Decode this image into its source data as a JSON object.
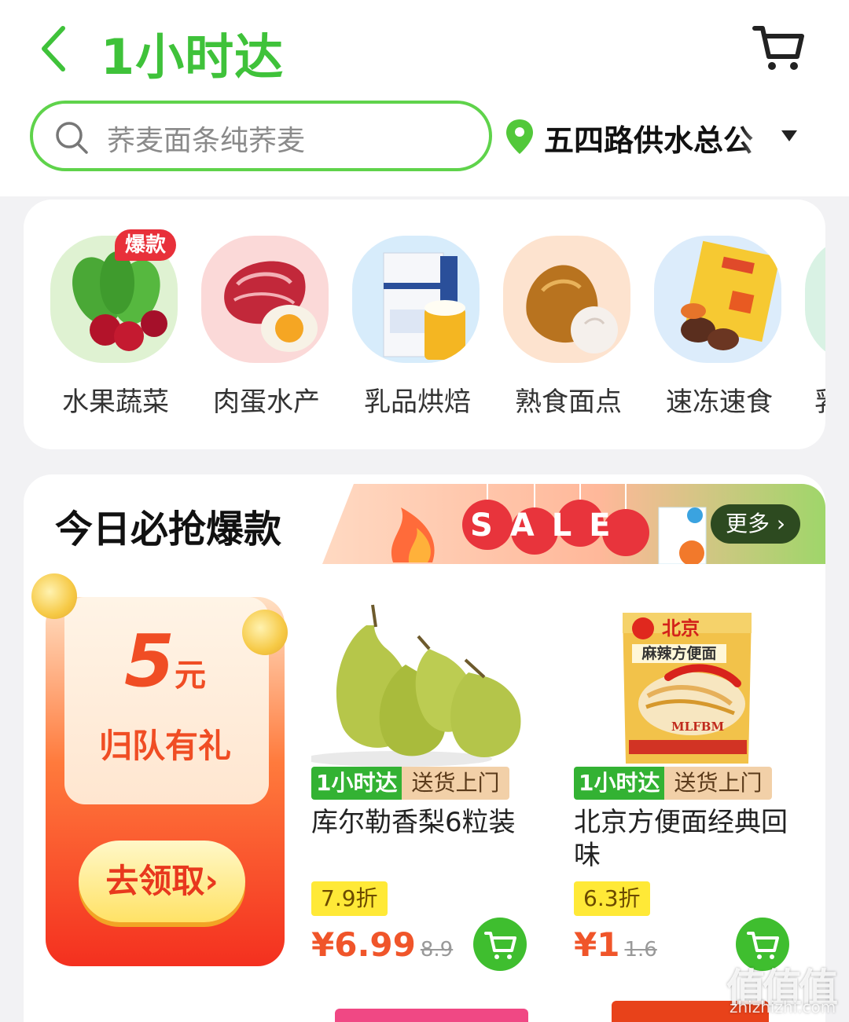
{
  "header": {
    "title": "1小时达",
    "back_icon": "chevron-left-icon",
    "cart_icon": "cart-icon"
  },
  "search": {
    "placeholder": "荞麦面条纯荞麦"
  },
  "location": {
    "text": "五四路供水总公"
  },
  "categories": [
    {
      "label": "水果蔬菜",
      "badge": "爆款"
    },
    {
      "label": "肉蛋水产"
    },
    {
      "label": "乳品烘焙"
    },
    {
      "label": "熟食面点"
    },
    {
      "label": "速冻速食"
    },
    {
      "label": "乳"
    }
  ],
  "deals": {
    "title": "今日必抢爆款",
    "banner_text": "SALE",
    "more": "更多"
  },
  "coupon": {
    "amount": "5",
    "unit": "元",
    "subtitle": "归队有礼",
    "button": "去领取"
  },
  "products": [
    {
      "tag_primary": "1小时达",
      "tag_secondary": "送货上门",
      "name": "库尔勒香梨6粒装",
      "discount": "7.9折",
      "price": "¥6.99",
      "original_price": "8.9"
    },
    {
      "tag_primary": "1小时达",
      "tag_secondary": "送货上门",
      "name": "北京方便面经典回味",
      "discount": "6.3折",
      "price": "¥1",
      "original_price": "1.6",
      "package_brand": "北京",
      "package_text": "麻辣方便面",
      "package_code": "MLFBM"
    }
  ],
  "watermark": {
    "main": "值值值",
    "site": "zhizhizhi.com"
  },
  "colors": {
    "brand_green": "#3fc23a",
    "price_orange": "#f0552a",
    "discount_yellow": "#ffe937"
  }
}
